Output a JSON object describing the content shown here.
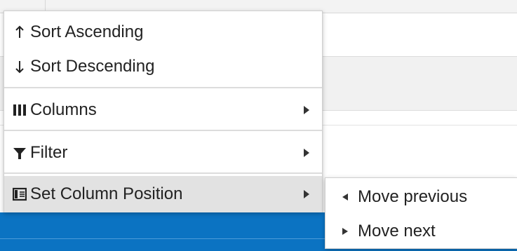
{
  "context_menu": {
    "items": [
      {
        "label": "Sort Ascending",
        "icon": "arrow-up-icon",
        "has_submenu": false
      },
      {
        "label": "Sort Descending",
        "icon": "arrow-down-icon",
        "has_submenu": false
      },
      {
        "label": "Columns",
        "icon": "columns-icon",
        "has_submenu": true
      },
      {
        "label": "Filter",
        "icon": "filter-icon",
        "has_submenu": true
      },
      {
        "label": "Set Column Position",
        "icon": "column-position-icon",
        "has_submenu": true,
        "highlighted": true
      }
    ]
  },
  "submenu": {
    "items": [
      {
        "label": "Move previous",
        "icon": "triangle-left-icon"
      },
      {
        "label": "Move next",
        "icon": "triangle-right-icon"
      }
    ]
  },
  "colors": {
    "selected_row": "#0b73c2",
    "hovered_item": "#e2e2e2",
    "menu_border": "#cfcfcf",
    "text": "#222222"
  }
}
